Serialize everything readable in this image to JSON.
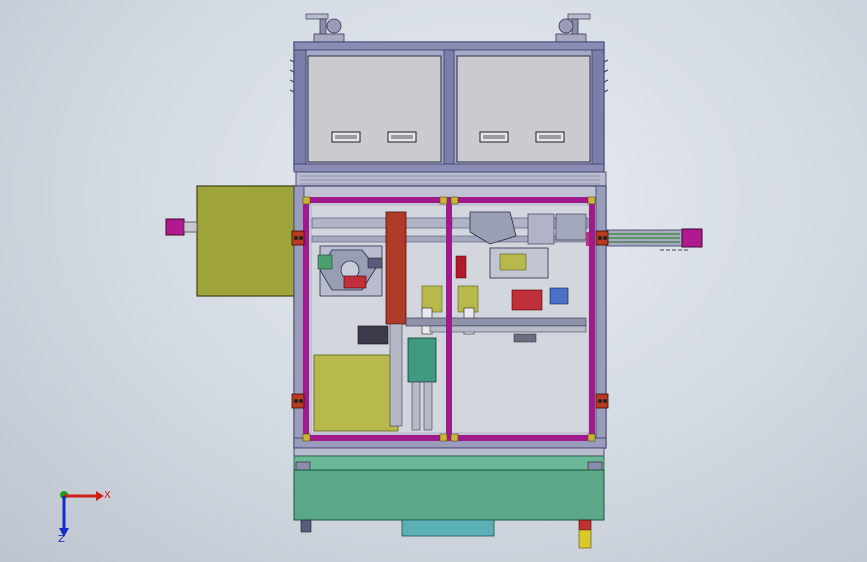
{
  "view": {
    "triad": {
      "x_label": "X",
      "z_label": "Z"
    }
  },
  "colors": {
    "background": "#d3d9e1",
    "frame": "#5a5a8c",
    "frame_light": "#7a7aa8",
    "magenta": "#a01a8c",
    "magenta_dark": "#7a1070",
    "olive": "#9ea43a",
    "olive_dark": "#6f7420",
    "teal": "#5aa888",
    "teal_dark": "#3f8a6c",
    "red_column": "#b03a28",
    "drawer_gray": "#c8c8cc",
    "axis_x": "#d0201a",
    "axis_y": "#1aa01a",
    "axis_z": "#1a28c8"
  }
}
